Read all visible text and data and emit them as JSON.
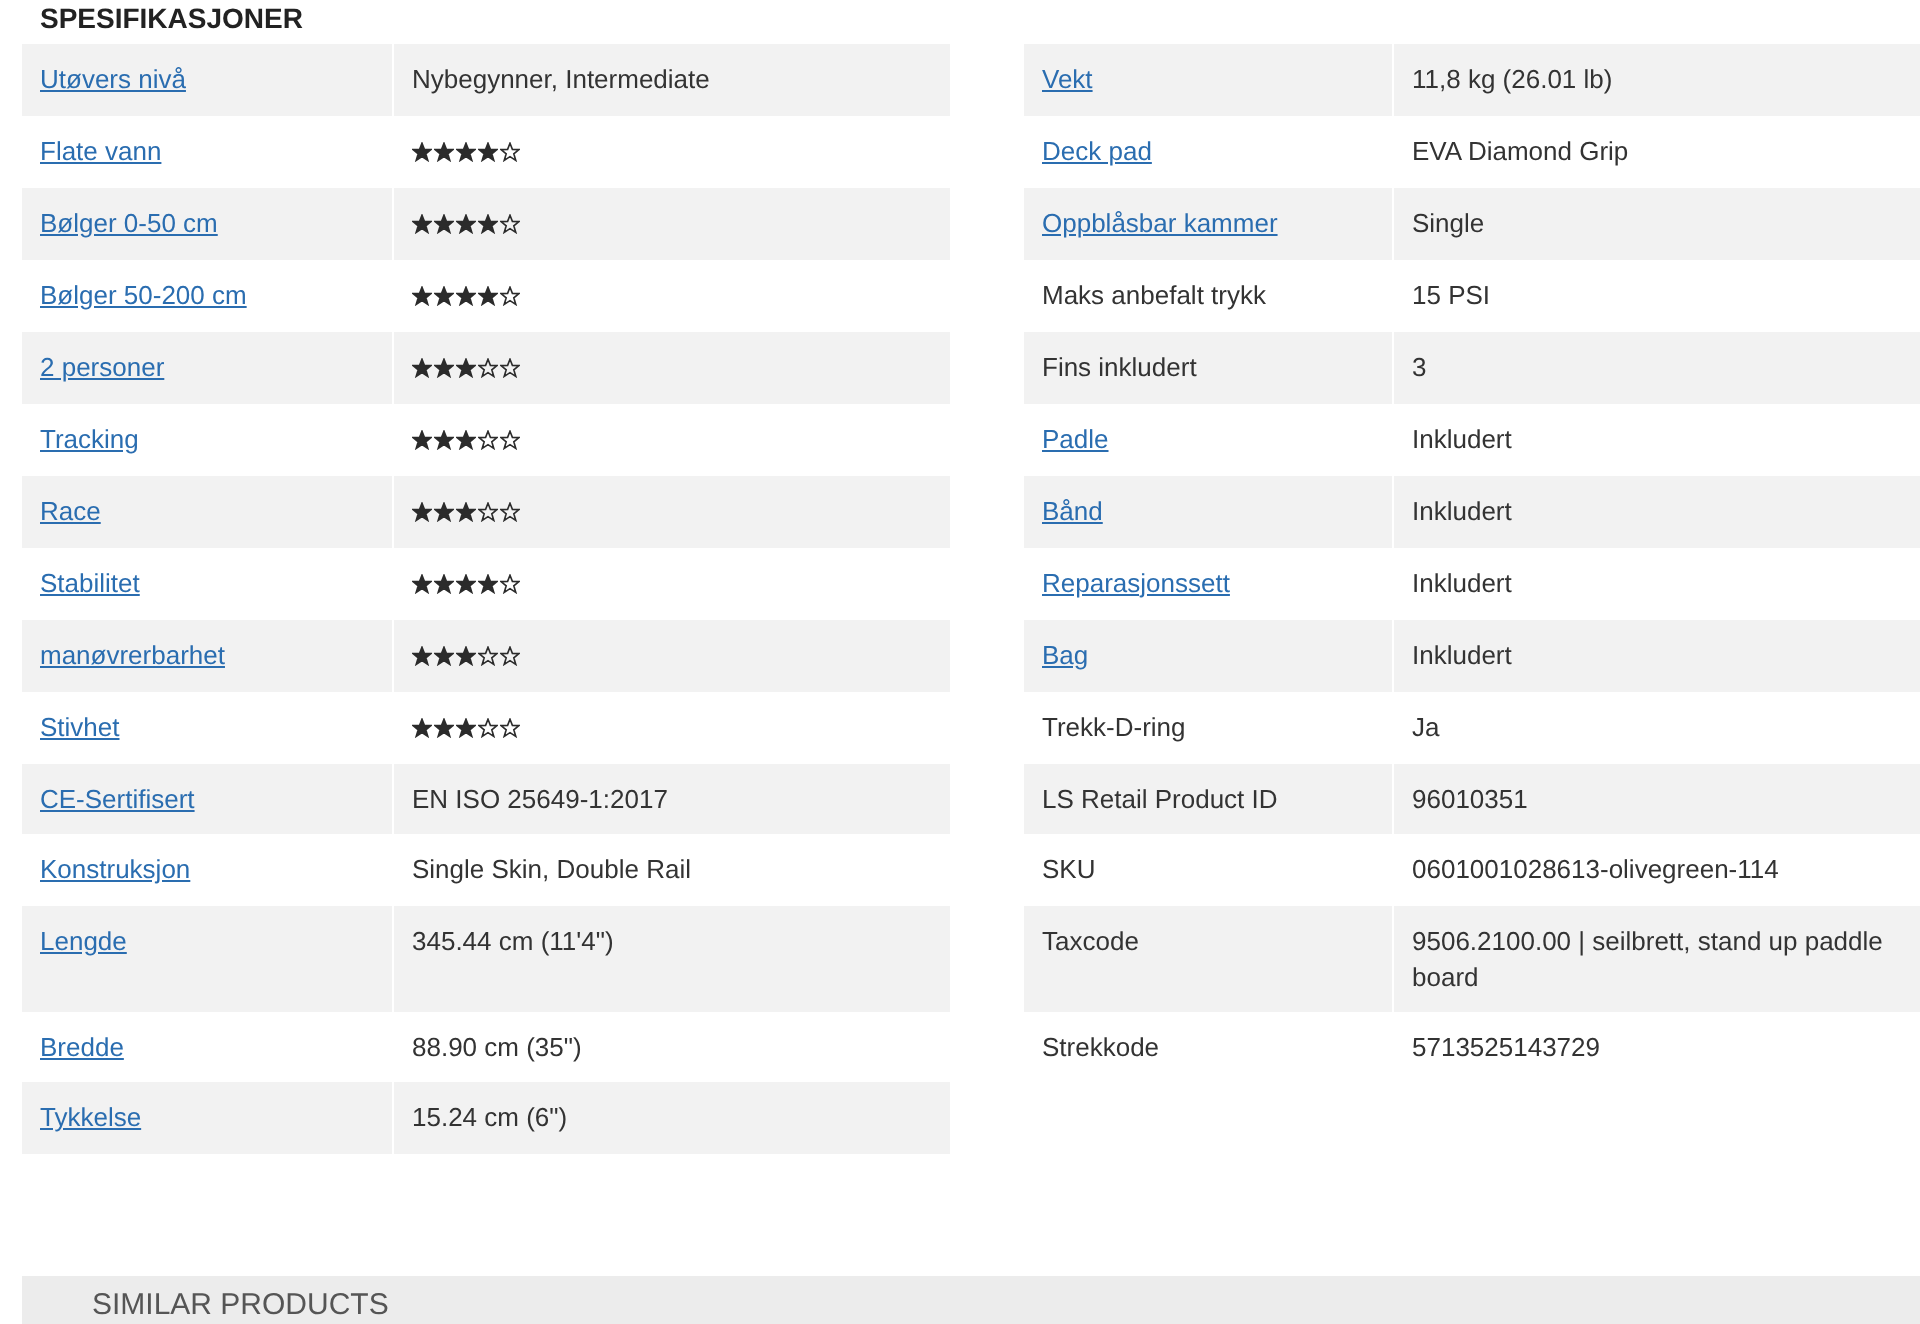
{
  "heading": "SPESIFIKASJONER",
  "left_rows": [
    {
      "label": "Utøvers nivå",
      "link": true,
      "kind": "text",
      "value": "Nybegynner, Intermediate"
    },
    {
      "label": "Flate vann",
      "link": true,
      "kind": "stars",
      "stars": 4
    },
    {
      "label": "Bølger 0-50 cm",
      "link": true,
      "kind": "stars",
      "stars": 4
    },
    {
      "label": "Bølger 50-200 cm",
      "link": true,
      "kind": "stars",
      "stars": 4
    },
    {
      "label": "2 personer",
      "link": true,
      "kind": "stars",
      "stars": 3
    },
    {
      "label": "Tracking",
      "link": true,
      "kind": "stars",
      "stars": 3
    },
    {
      "label": "Race",
      "link": true,
      "kind": "stars",
      "stars": 3
    },
    {
      "label": "Stabilitet",
      "link": true,
      "kind": "stars",
      "stars": 4
    },
    {
      "label": "manøvrerbarhet",
      "link": true,
      "kind": "stars",
      "stars": 3
    },
    {
      "label": "Stivhet",
      "link": true,
      "kind": "stars",
      "stars": 3
    },
    {
      "label": "CE-Sertifisert",
      "link": true,
      "kind": "text",
      "value": "EN ISO 25649-1:2017"
    },
    {
      "label": "Konstruksjon",
      "link": true,
      "kind": "text",
      "value": "Single Skin, Double Rail"
    },
    {
      "label": "Lengde",
      "link": true,
      "kind": "text",
      "value": "345.44 cm (11'4\")"
    },
    {
      "label": "Bredde",
      "link": true,
      "kind": "text",
      "value": "88.90 cm (35\")"
    },
    {
      "label": "Tykkelse",
      "link": true,
      "kind": "text",
      "value": "15.24 cm (6\")"
    }
  ],
  "right_rows": [
    {
      "label": "Vekt",
      "link": true,
      "kind": "text",
      "value": "11,8 kg (26.01 lb)"
    },
    {
      "label": "Deck pad",
      "link": true,
      "kind": "text",
      "value": "EVA Diamond Grip"
    },
    {
      "label": "Oppblåsbar kammer",
      "link": true,
      "kind": "text",
      "value": "Single"
    },
    {
      "label": "Maks anbefalt trykk",
      "link": false,
      "kind": "text",
      "value": "15 PSI"
    },
    {
      "label": "Fins inkludert",
      "link": false,
      "kind": "text",
      "value": "3"
    },
    {
      "label": "Padle",
      "link": true,
      "kind": "text",
      "value": "Inkludert"
    },
    {
      "label": "Bånd",
      "link": true,
      "kind": "text",
      "value": "Inkludert"
    },
    {
      "label": "Reparasjonssett",
      "link": true,
      "kind": "text",
      "value": "Inkludert"
    },
    {
      "label": "Bag",
      "link": true,
      "kind": "text",
      "value": "Inkludert"
    },
    {
      "label": "Trekk-D-ring",
      "link": false,
      "kind": "text",
      "value": "Ja"
    },
    {
      "label": "LS Retail Product ID",
      "link": false,
      "kind": "text",
      "value": "96010351"
    },
    {
      "label": "SKU",
      "link": false,
      "kind": "text",
      "value": "0601001028613-olivegreen-114"
    },
    {
      "label": "Taxcode",
      "link": false,
      "kind": "text",
      "value": "9506.2100.00 | seilbrett, stand up paddle board"
    },
    {
      "label": "Strekkode",
      "link": false,
      "kind": "text",
      "value": "5713525143729"
    }
  ],
  "similar_products": {
    "title": "SIMILAR PRODUCTS"
  }
}
